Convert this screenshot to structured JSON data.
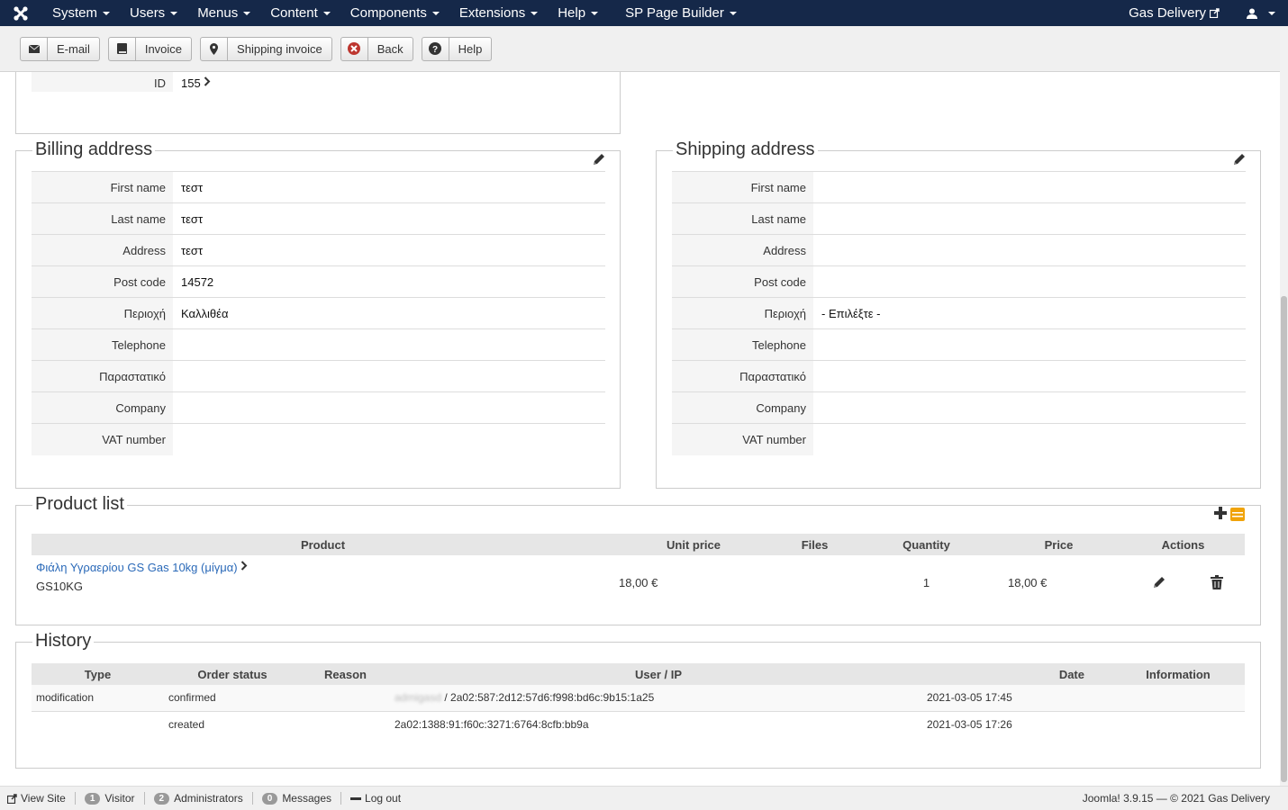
{
  "nav": {
    "menus": [
      "System",
      "Users",
      "Menus",
      "Content",
      "Components",
      "Extensions",
      "Help",
      "SP Page Builder"
    ],
    "site_name": "Gas Delivery"
  },
  "toolbar": {
    "email": "E-mail",
    "invoice": "Invoice",
    "shipping_invoice": "Shipping invoice",
    "back": "Back",
    "help": "Help"
  },
  "order": {
    "id_label": "ID",
    "id_value": "155"
  },
  "billing": {
    "title": "Billing address",
    "rows": [
      {
        "label": "First name",
        "value": "τεστ"
      },
      {
        "label": "Last name",
        "value": "τεστ"
      },
      {
        "label": "Address",
        "value": "τεστ"
      },
      {
        "label": "Post code",
        "value": "14572"
      },
      {
        "label": "Περιοχή",
        "value": "Καλλιθέα"
      },
      {
        "label": "Telephone",
        "value": ""
      },
      {
        "label": "Παραστατικό",
        "value": ""
      },
      {
        "label": "Company",
        "value": ""
      },
      {
        "label": "VAT number",
        "value": ""
      }
    ]
  },
  "shipping": {
    "title": "Shipping address",
    "rows": [
      {
        "label": "First name",
        "value": ""
      },
      {
        "label": "Last name",
        "value": ""
      },
      {
        "label": "Address",
        "value": ""
      },
      {
        "label": "Post code",
        "value": ""
      },
      {
        "label": "Περιοχή",
        "value": "- Επιλέξτε -"
      },
      {
        "label": "Telephone",
        "value": ""
      },
      {
        "label": "Παραστατικό",
        "value": ""
      },
      {
        "label": "Company",
        "value": ""
      },
      {
        "label": "VAT number",
        "value": ""
      }
    ]
  },
  "products": {
    "title": "Product list",
    "headers": [
      "Product",
      "Unit price",
      "Files",
      "Quantity",
      "Price",
      "Actions"
    ],
    "items": [
      {
        "name": "Φιάλη Υγραερίου GS Gas 10kg (μίγμα)",
        "sku": "GS10KG",
        "unit_price": "18,00 €",
        "files": "",
        "quantity": "1",
        "price": "18,00 €"
      }
    ]
  },
  "history": {
    "title": "History",
    "headers": [
      "Type",
      "Order status",
      "Reason",
      "User / IP",
      "Date",
      "Information"
    ],
    "rows": [
      {
        "type": "modification",
        "status": "confirmed",
        "reason": "",
        "user": "admigasd",
        "ip": " / 2a02:587:2d12:57d6:f998:bd6c:9b15:1a25",
        "date": "2021-03-05 17:45",
        "info": ""
      },
      {
        "type": "",
        "status": "created",
        "reason": "",
        "user": "",
        "ip": "2a02:1388:91:f60c:3271:6764:8cfb:bb9a",
        "date": "2021-03-05 17:26",
        "info": ""
      }
    ]
  },
  "footer": {
    "view_site": "View Site",
    "visitors_count": "1",
    "visitors_label": "Visitor",
    "admins_count": "2",
    "admins_label": "Administrators",
    "messages_count": "0",
    "messages_label": "Messages",
    "logout": "Log out",
    "version": "Joomla! 3.9.15 — © 2021 Gas Delivery"
  }
}
